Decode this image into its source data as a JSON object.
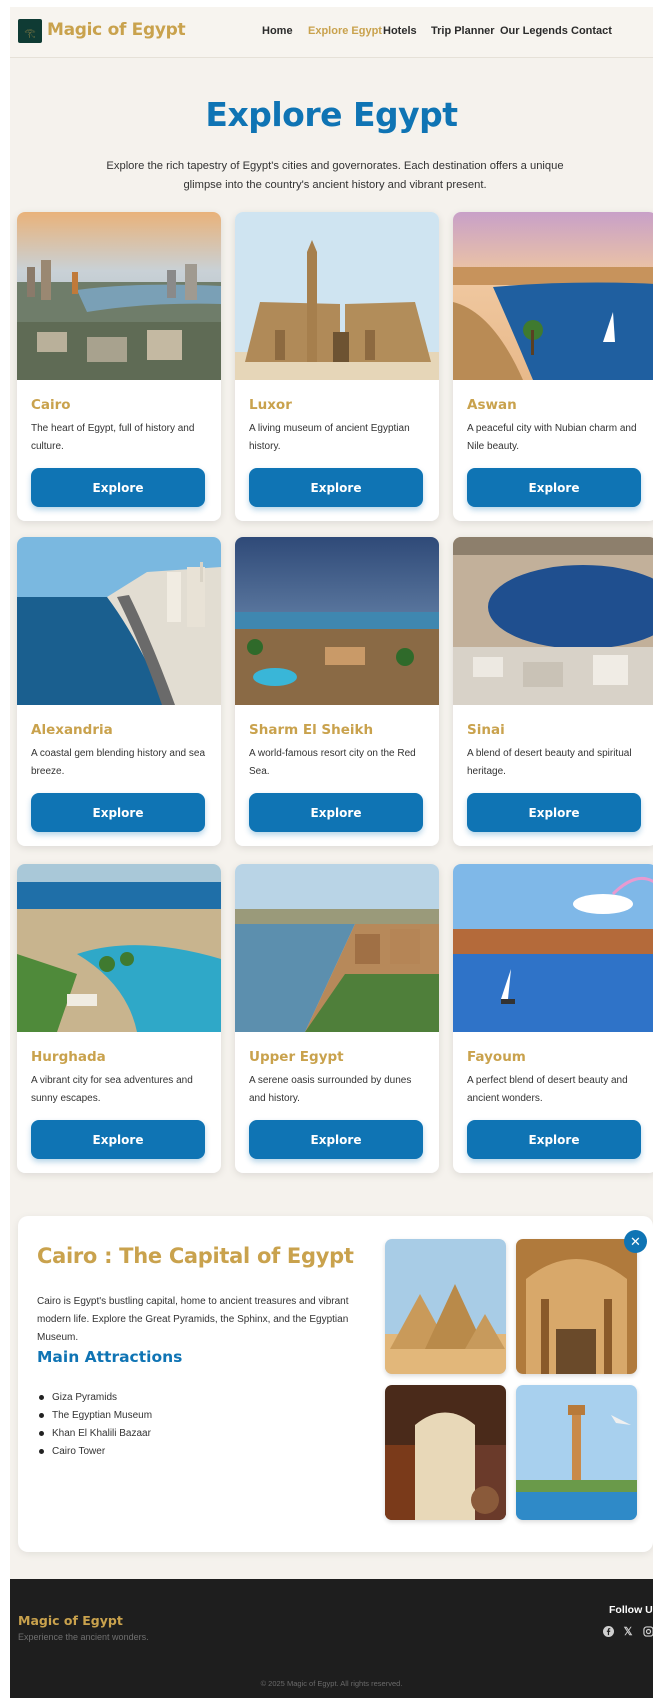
{
  "brand": {
    "name": "Magic of Egypt",
    "logo_icon": "pharaoh-logo-icon"
  },
  "nav": {
    "items": [
      {
        "label": "Home",
        "active": false
      },
      {
        "label": "Explore Egypt",
        "active": true
      },
      {
        "label": "Hotels",
        "active": false
      },
      {
        "label": "Trip Planner",
        "active": false
      },
      {
        "label": "Our Legends",
        "active": false
      },
      {
        "label": "Contact",
        "active": false
      }
    ]
  },
  "hero": {
    "title": "Explore Egypt",
    "subtitle": "Explore the rich tapestry of Egypt's cities and governorates. Each destination offers a unique glimpse into the country's ancient history and vibrant present."
  },
  "destinations": [
    {
      "name": "Cairo",
      "description": "The heart of Egypt, full of history and culture.",
      "button": "Explore"
    },
    {
      "name": "Luxor",
      "description": "A living museum of ancient Egyptian history.",
      "button": "Explore"
    },
    {
      "name": "Aswan",
      "description": "A peaceful city with Nubian charm and Nile beauty.",
      "button": "Explore"
    },
    {
      "name": "Alexandria",
      "description": "A coastal gem blending history and sea breeze.",
      "button": "Explore"
    },
    {
      "name": "Sharm El Sheikh",
      "description": "A world-famous resort city on the Red Sea.",
      "button": "Explore"
    },
    {
      "name": "Sinai",
      "description": "A blend of desert beauty and spiritual heritage.",
      "button": "Explore"
    },
    {
      "name": "Hurghada",
      "description": "A vibrant city for sea adventures and sunny escapes.",
      "button": "Explore"
    },
    {
      "name": "Upper Egypt",
      "description": "A serene oasis surrounded by dunes and history.",
      "button": "Explore"
    },
    {
      "name": "Fayoum",
      "description": "A perfect blend of desert beauty and ancient wonders.",
      "button": "Explore"
    }
  ],
  "detail": {
    "title": "Cairo : The Capital of Egypt",
    "text": "Cairo is Egypt's bustling capital, home to ancient treasures and vibrant modern life. Explore the Great Pyramids, the Sphinx, and the Egyptian Museum.",
    "attractions_heading": "Main Attractions",
    "attractions": [
      "Giza Pyramids",
      "The Egyptian Museum",
      "Khan El Khalili Bazaar",
      "Cairo Tower"
    ],
    "close_icon": "close-icon"
  },
  "footer": {
    "brand": "Magic of Egypt",
    "tagline": "Experience the ancient wonders.",
    "follow_label": "Follow Us",
    "social_icons": [
      "facebook-icon",
      "x-icon",
      "instagram-icon"
    ],
    "copyright": "© 2025 Magic of Egypt. All rights reserved."
  },
  "colors": {
    "primary": "#0f74b4",
    "gold": "#c9a24d",
    "background": "#f5f2ed",
    "footer": "#1e1e1e"
  }
}
